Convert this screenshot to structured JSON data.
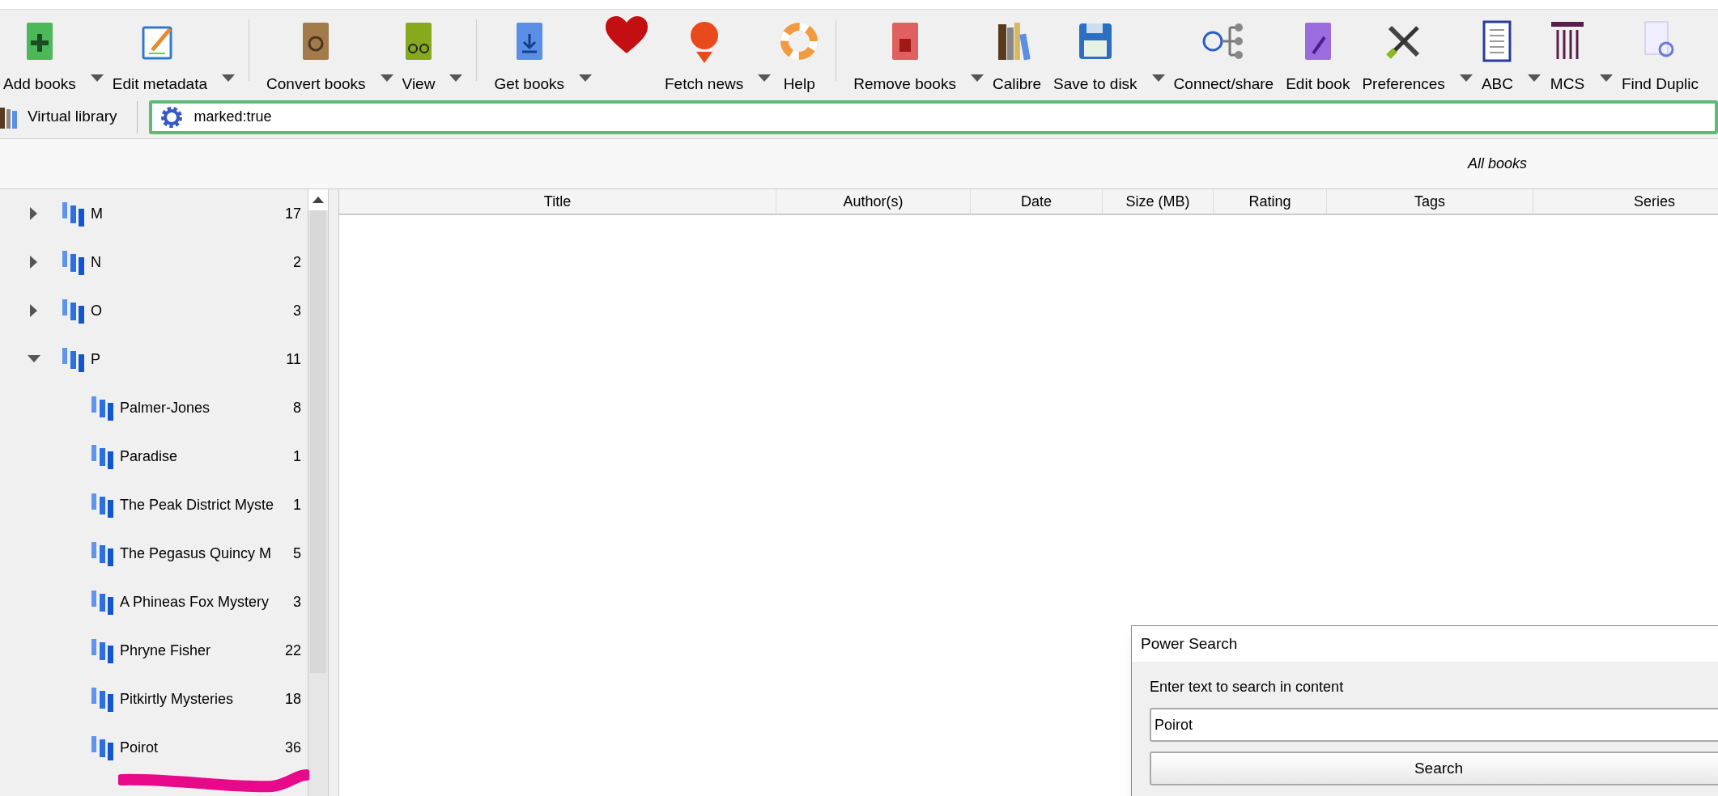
{
  "toolbar": [
    {
      "kind": "button",
      "label": "Add books",
      "menu": true
    },
    {
      "kind": "button",
      "label": "Edit metadata",
      "menu": true
    },
    {
      "kind": "separator"
    },
    {
      "kind": "button",
      "label": "Convert books",
      "menu": true
    },
    {
      "kind": "button",
      "label": "View",
      "menu": true
    },
    {
      "kind": "separator"
    },
    {
      "kind": "button",
      "label": "Get books",
      "menu": true
    },
    {
      "kind": "icon"
    },
    {
      "kind": "button",
      "label": "Fetch news",
      "menu": true
    },
    {
      "kind": "button",
      "label": "Help",
      "menu": false
    },
    {
      "kind": "separator"
    },
    {
      "kind": "button",
      "label": "Remove books",
      "menu": true
    },
    {
      "kind": "button",
      "label": "Calibre",
      "menu": false
    },
    {
      "kind": "button",
      "label": "Save to disk",
      "menu": true
    },
    {
      "kind": "button",
      "label": "Connect/share",
      "menu": false
    },
    {
      "kind": "button",
      "label": "Edit book",
      "menu": false
    },
    {
      "kind": "button",
      "label": "Preferences",
      "menu": true
    },
    {
      "kind": "button",
      "label": "ABC",
      "menu": true
    },
    {
      "kind": "button",
      "label": "MCS",
      "menu": true
    },
    {
      "kind": "button",
      "label": "Find Duplic",
      "menu": false
    }
  ],
  "virtual_library": "Virtual library",
  "search": {
    "value": "marked:true"
  },
  "library_label": "All books",
  "tree": [
    {
      "label": "M",
      "count": "17",
      "expanded": false
    },
    {
      "label": "N",
      "count": "2",
      "expanded": false
    },
    {
      "label": "O",
      "count": "3",
      "expanded": false
    },
    {
      "label": "P",
      "count": "11",
      "expanded": true,
      "children": [
        {
          "label": "Palmer-Jones",
          "count": "8"
        },
        {
          "label": "Paradise",
          "count": "1"
        },
        {
          "label": "The Peak District Myste",
          "count": "1"
        },
        {
          "label": "The Pegasus Quincy M",
          "count": "5"
        },
        {
          "label": "A Phineas Fox Mystery",
          "count": "3"
        },
        {
          "label": "Phryne Fisher",
          "count": "22"
        },
        {
          "label": "Pitkirtly Mysteries",
          "count": "18"
        },
        {
          "label": "Poirot",
          "count": "36"
        }
      ]
    }
  ],
  "table": {
    "columns": [
      "Title",
      "Author(s)",
      "Date",
      "Size (MB)",
      "Rating",
      "Tags",
      "Series"
    ]
  },
  "power_search": {
    "title": "Power Search",
    "label": "Enter text to search in content",
    "value": "Poirot",
    "button": "Search"
  }
}
